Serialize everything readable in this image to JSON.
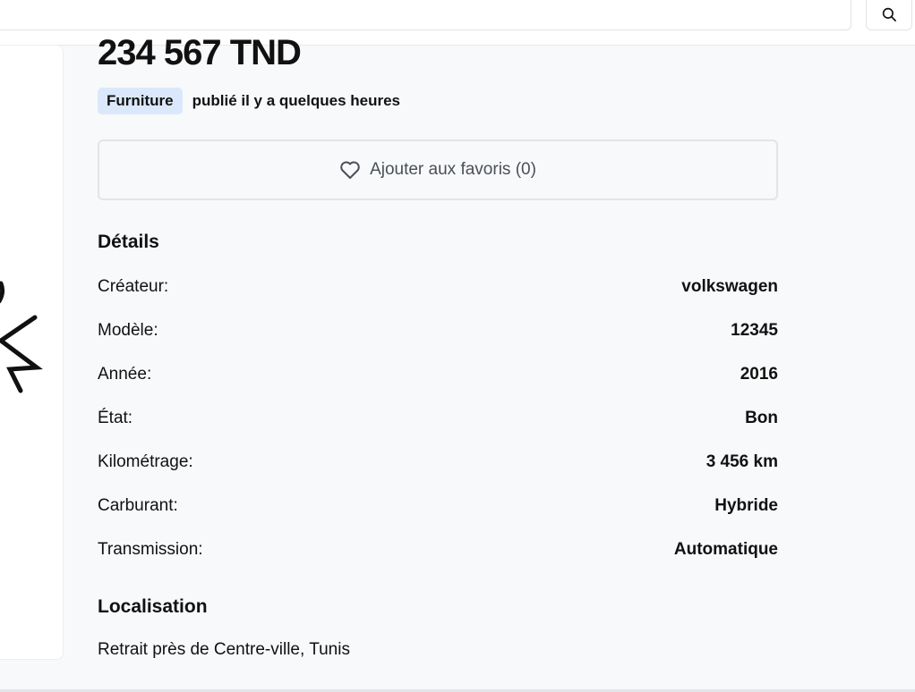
{
  "header": {
    "search_placeholder": "",
    "search_button_icon": "search-icon"
  },
  "listing": {
    "price": "234 567 TND",
    "category": "Furniture",
    "posted": "publié il y a quelques heures",
    "favorite_label": "Ajouter aux favoris (0)",
    "favorite_icon": "heart-outline-icon"
  },
  "details": {
    "title": "Détails",
    "rows": [
      {
        "label": "Créateur:",
        "value": "volkswagen"
      },
      {
        "label": "Modèle:",
        "value": "12345"
      },
      {
        "label": "Année:",
        "value": "2016"
      },
      {
        "label": "État:",
        "value": "Bon"
      },
      {
        "label": "Kilométrage:",
        "value": "3 456 km"
      },
      {
        "label": "Carburant:",
        "value": "Hybride"
      },
      {
        "label": "Transmission:",
        "value": "Automatique"
      }
    ]
  },
  "location": {
    "title": "Localisation",
    "text": "Retrait près de Centre-ville, Tunis"
  },
  "colors": {
    "background": "#f8f9fb",
    "badge_bg": "#dbe8fb",
    "border": "#e2e4e8",
    "muted_text": "#4a4f57"
  }
}
